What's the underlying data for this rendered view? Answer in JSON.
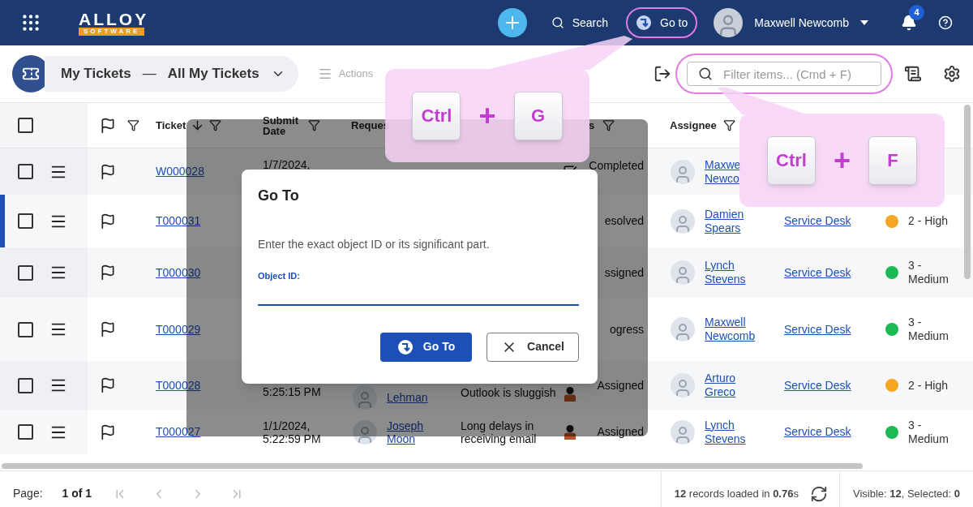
{
  "topbar": {
    "logo_main": "ALLOY",
    "logo_sub": "SOFTWARE",
    "search": "Search",
    "goto": "Go to",
    "user": "Maxwell Newcomb",
    "notifications": "4"
  },
  "toolbar": {
    "title": "My Tickets",
    "separator": "—",
    "view": "All My Tickets",
    "actions": "Actions",
    "filter_placeholder": "Filter items... (Cmd + F)"
  },
  "table": {
    "columns": [
      {
        "label": "Ticket",
        "sorted": true
      },
      {
        "label": "Submit Date",
        "sorted": false
      },
      {
        "label": "Reques",
        "sorted": false
      },
      {
        "label": "s",
        "sorted": false
      },
      {
        "label": "Assignee",
        "sorted": false
      }
    ],
    "select_all": {
      "checked": false
    },
    "rows": [
      {
        "selected": false,
        "checked": false,
        "kind": "completed",
        "ticket": "W000028",
        "submit_date": "1/7/2024,",
        "status": "Completed",
        "assignee": "Maxwe Newco"
      },
      {
        "selected": true,
        "checked": false,
        "ticket": "T000031",
        "status": "esolved",
        "assignee": "Damien Spears",
        "group": "Service Desk",
        "priority": {
          "label": "2 - High",
          "color": "#f5a623"
        }
      },
      {
        "selected": false,
        "checked": false,
        "ticket": "T000030",
        "status": "ssigned",
        "assignee": "Lynch Stevens",
        "group": "Service Desk",
        "priority": {
          "label": "3 - Medium",
          "color": "#1db954"
        }
      },
      {
        "selected": false,
        "checked": false,
        "ticket": "T000029",
        "status": "ogress",
        "assignee": "Maxwell Newcomb",
        "group": "Service Desk",
        "priority": {
          "label": "3 - Medium",
          "color": "#1db954"
        }
      },
      {
        "selected": false,
        "checked": false,
        "kind": "assigned",
        "ticket": "T000028",
        "submit_date": "5:25:15 PM",
        "requester": "Lehman",
        "description": "Outlook is sluggish",
        "status": "Assigned",
        "assignee": "Arturo Greco",
        "group": "Service Desk",
        "priority": {
          "label": "2 - High",
          "color": "#f5a623"
        }
      },
      {
        "selected": false,
        "checked": false,
        "kind": "assigned",
        "ticket": "T000027",
        "submit_date": "1/1/2024, 5:22:59 PM",
        "requester": "Joseph Moon",
        "description": "Long delays in receiving email",
        "status": "Assigned",
        "assignee": "Lynch Stevens",
        "group": "Service Desk",
        "priority": {
          "label": "3 - Medium",
          "color": "#1db954"
        }
      }
    ]
  },
  "dialog": {
    "title": "Go To",
    "message": "Enter the exact object ID or its significant part.",
    "field_label": "Object ID:",
    "buttons": [
      {
        "label": "Go To",
        "kind": "primary"
      },
      {
        "label": "Cancel",
        "kind": "cancel"
      }
    ]
  },
  "callouts": [
    {
      "keys": [
        "Ctrl",
        "G"
      ],
      "joiner": "+"
    },
    {
      "keys": [
        "Ctrl",
        "F"
      ],
      "joiner": "+"
    }
  ],
  "footer": {
    "page_label": "Page:",
    "page": "1 of 1",
    "records": "**12** records loaded in **0.76**s",
    "visibility": "Visible: **12**, Selected: **0**"
  }
}
